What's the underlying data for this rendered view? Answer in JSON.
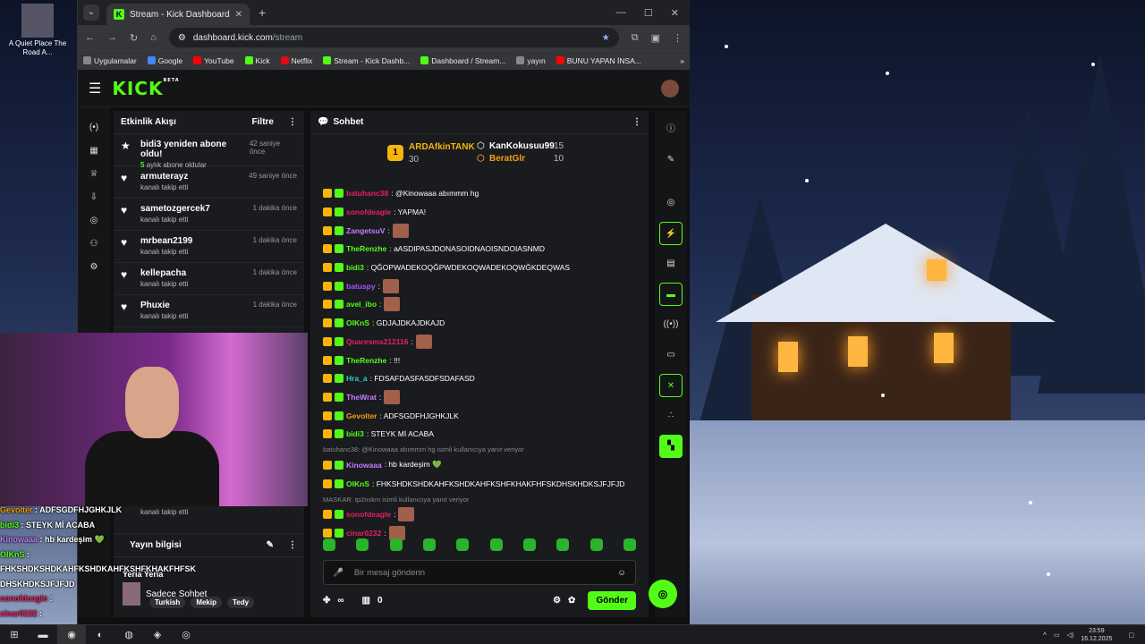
{
  "desktop": {
    "icon_label": "A Quiet Place The Road A..."
  },
  "browser": {
    "tab_title": "Stream - Kick Dashboard",
    "url_host": "dashboard.kick.com",
    "url_path": "/stream",
    "bookmarks": [
      {
        "label": "Uygulamalar",
        "color": "#888888"
      },
      {
        "label": "Google",
        "color": "#4285f4"
      },
      {
        "label": "YouTube",
        "color": "#ff0000"
      },
      {
        "label": "Kick",
        "color": "#53fc18"
      },
      {
        "label": "Netflix",
        "color": "#e50914"
      },
      {
        "label": "Stream - Kick Dashb...",
        "color": "#53fc18"
      },
      {
        "label": "Dashboard / Stream...",
        "color": "#53fc18"
      },
      {
        "label": "yayın",
        "color": "#888888"
      },
      {
        "label": "BUNU YAPAN İNSA...",
        "color": "#ff0000"
      }
    ]
  },
  "kick": {
    "logo": "KICK",
    "logo_sup": "BETA",
    "activity": {
      "title": "Etkinlik Akışı",
      "filter": "Filtre",
      "items": [
        {
          "name": "bidi3 yeniden abone oldu!",
          "time": "42 saniye önce",
          "sub_count": "5",
          "sub": "aylık abone oldular",
          "icon": "★"
        },
        {
          "name": "armuterayz",
          "time": "49 saniye önce",
          "sub": "kanalı takip etti",
          "icon": "♥"
        },
        {
          "name": "sametozgercek7",
          "time": "1 dakika önce",
          "sub": "kanalı takip etti",
          "icon": "♥"
        },
        {
          "name": "mrbean2199",
          "time": "1 dakika önce",
          "sub": "kanalı takip etti",
          "icon": "♥"
        },
        {
          "name": "kellepacha",
          "time": "1 dakika önce",
          "sub": "kanalı takip etti",
          "icon": "♥"
        },
        {
          "name": "Phuxie",
          "time": "1 dakika önce",
          "sub": "kanalı takip etti",
          "icon": "♥"
        }
      ],
      "last_sub": "kanalı takip etti"
    },
    "stream_info": {
      "title": "Yayın bilgisi",
      "overlay_name": "Yeria Yeria",
      "category": "Sadece Sohbet",
      "tags": [
        "Turkish",
        "Mekip",
        "Tedy"
      ]
    },
    "chat": {
      "title": "Sohbet",
      "leaderboard": [
        {
          "rank": "1",
          "name": "ARDAfkinTANK",
          "count": "30"
        },
        {
          "name": "KanKokusuu99",
          "count": "15"
        },
        {
          "name": "BeratGlr",
          "count": "10"
        }
      ],
      "messages": [
        {
          "user": "batuhanc38",
          "color": "#e91e63",
          "text": ": @Kinowaaa abımmm hg",
          "emote": false
        },
        {
          "user": "sonofdeagle",
          "color": "#e91e63",
          "text": ": YAPMA!",
          "emote": false
        },
        {
          "user": "ZangetsuV",
          "color": "#c77dff",
          "text": ":",
          "emote": true
        },
        {
          "user": "TheRenzhe",
          "color": "#53fc18",
          "text": ": aASDIPASJDONASOIDNAOISNDOIASNMD",
          "emote": false
        },
        {
          "user": "bidi3",
          "color": "#53fc18",
          "text": ": QĞOPWADEKOQĞPWDEKOQWADEKOQWĞKDEQWAS",
          "emote": false
        },
        {
          "user": "batuspy",
          "color": "#a855f7",
          "text": ":",
          "emote": true
        },
        {
          "user": "avel_ibo",
          "color": "#53fc18",
          "text": ":",
          "emote": true
        },
        {
          "user": "OIKnS",
          "color": "#53fc18",
          "text": ": GDJAJDKAJDKAJD",
          "emote": false
        },
        {
          "user": "Quaresma212116",
          "color": "#e91e63",
          "text": ":",
          "emote": true
        },
        {
          "user": "TheRenzhe",
          "color": "#53fc18",
          "text": ": !!!",
          "emote": false
        },
        {
          "user": "Hra_a",
          "color": "#2dd4bf",
          "text": ": FDSAFDASFASDFSDAFASD",
          "emote": false
        },
        {
          "user": "TheWrat",
          "color": "#c77dff",
          "text": ":",
          "emote": true
        },
        {
          "user": "Gevolter",
          "color": "#f59e0b",
          "text": ": ADFSGDFHJGHKJLK",
          "emote": false
        },
        {
          "user": "bidi3",
          "color": "#53fc18",
          "text": ": STEYK Mİ ACABA",
          "emote": false
        }
      ],
      "reply1": "batuhanc38: @Kinowaaa abımmm hg isimli kullanıcıya yanıt veriyor",
      "msg_kinowaaa": {
        "user": "Kinowaaa",
        "color": "#c77dff",
        "text": ": hb kardeşim 💚"
      },
      "msg_oikns": {
        "user": "OIKnS",
        "color": "#53fc18",
        "text": ": FHKSHDKSHDKAHFKSHDKAHFKSHFKHAKFHFSKDHSKHDKSJFJFJD"
      },
      "reply2": "MASKAR: tp2nskm isimli kullanıcıya yanıt veriyor",
      "msg_sonof": {
        "user": "sonofdeagle",
        "color": "#e91e63",
        "text": ":"
      },
      "msg_cinar": {
        "user": "cinar0232",
        "color": "#e91e63",
        "text": ":"
      },
      "input_placeholder": "Bir mesaj gönderin",
      "points": "∞",
      "bag_count": "0",
      "send": "Gönder"
    }
  },
  "overlay_chat": [
    {
      "user": "Gevolter",
      "color": "#f59e0b",
      "text": " : ADFSGDFHJGHKJLK"
    },
    {
      "user": "bidi3",
      "color": "#53fc18",
      "text": " : STEYK Mİ ACABA"
    },
    {
      "user": "Kinowaaa",
      "color": "#c77dff",
      "text": " : hb kardeşim 💚"
    },
    {
      "user": "OIKnS",
      "color": "#53fc18",
      "text": " :"
    },
    {
      "user": "",
      "color": "#ffffff",
      "text": "FHKSHDKSHDKAHFKSHDKAHFKSHFKHAKFHFSK"
    },
    {
      "user": "",
      "color": "#ffffff",
      "text": "DHSKHDKSJFJFJD"
    },
    {
      "user": "sonofdeagle",
      "color": "#e91e63",
      "text": " :"
    },
    {
      "user": "cinar0232",
      "color": "#e91e63",
      "text": " :"
    }
  ],
  "taskbar": {
    "time": "23:59",
    "date": "16.12.2025"
  },
  "colors": {
    "accent": "#53fc18"
  }
}
